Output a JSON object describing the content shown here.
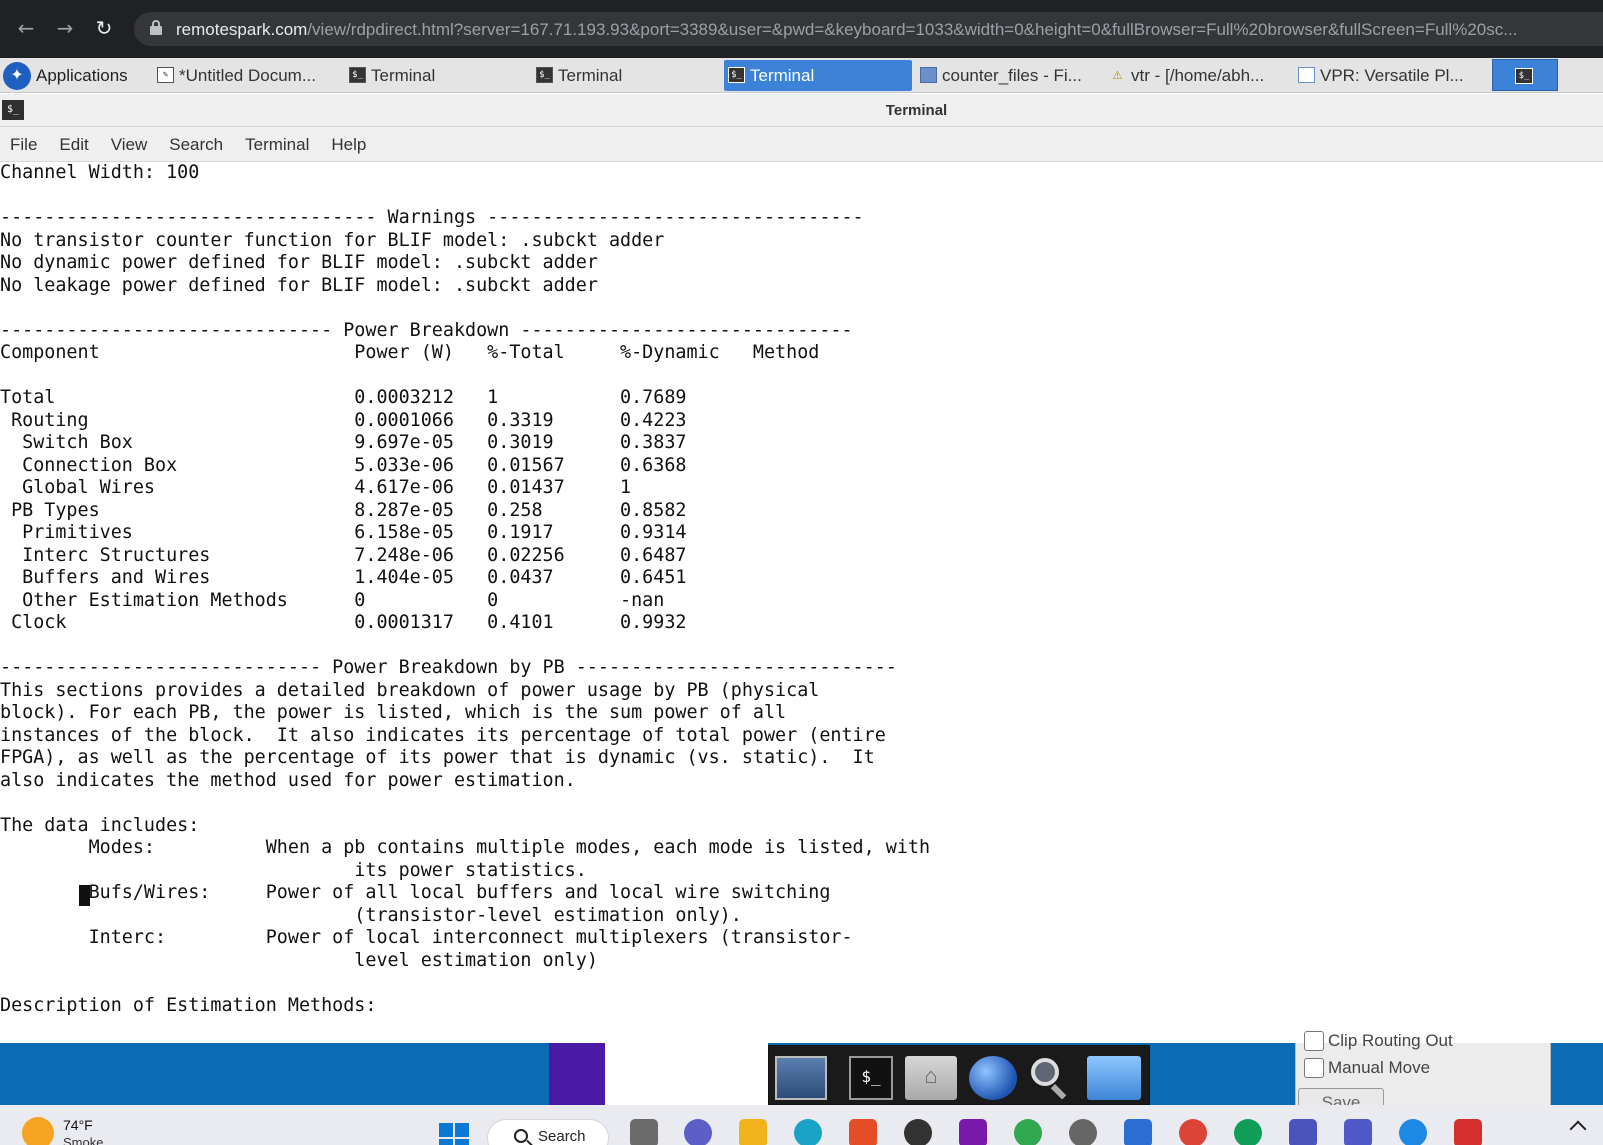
{
  "browser": {
    "url_host": "remotespark.com",
    "url_path": "/view/rdpdirect.html?server=167.71.193.93&port=3389&user=&pwd=&keyboard=1033&width=0&height=0&fullBrowser=Full%20browser&fullScreen=Full%20sc..."
  },
  "xfce_panel": {
    "applications_label": "Applications",
    "tasks": [
      {
        "label": "*Untitled Docum...",
        "icon": "document-icon"
      },
      {
        "label": "Terminal",
        "icon": "terminal-icon"
      },
      {
        "label": "Terminal",
        "icon": "terminal-icon"
      },
      {
        "label": "Terminal",
        "icon": "terminal-icon",
        "active": true
      },
      {
        "label": "counter_files - Fi...",
        "icon": "folder-icon"
      },
      {
        "label": "vtr - [/home/abh...",
        "icon": "vtr-icon"
      },
      {
        "label": "VPR: Versatile Pl...",
        "icon": "window-icon"
      }
    ]
  },
  "window": {
    "title": "Terminal",
    "menu": [
      "File",
      "Edit",
      "View",
      "Search",
      "Terminal",
      "Help"
    ]
  },
  "terminal": {
    "lines": [
      "Channel Width: 100",
      "",
      "---------------------------------- Warnings ----------------------------------",
      "No transistor counter function for BLIF model: .subckt adder",
      "No dynamic power defined for BLIF model: .subckt adder",
      "No leakage power defined for BLIF model: .subckt adder",
      "",
      "------------------------------ Power Breakdown ------------------------------",
      "Component                       Power (W)   %-Total     %-Dynamic   Method",
      "",
      "Total                           0.0003212   1           0.7689",
      " Routing                        0.0001066   0.3319      0.4223",
      "  Switch Box                    9.697e-05   0.3019      0.3837",
      "  Connection Box                5.033e-06   0.01567     0.6368",
      "  Global Wires                  4.617e-06   0.01437     1",
      " PB Types                       8.287e-05   0.258       0.8582",
      "  Primitives                    6.158e-05   0.1917      0.9314",
      "  Interc Structures             7.248e-06   0.02256     0.6487",
      "  Buffers and Wires             1.404e-05   0.0437      0.6451",
      "  Other Estimation Methods      0           0           -nan",
      " Clock                          0.0001317   0.4101      0.9932",
      "",
      "----------------------------- Power Breakdown by PB -----------------------------",
      "This sections provides a detailed breakdown of power usage by PB (physical",
      "block). For each PB, the power is listed, which is the sum power of all",
      "instances of the block.  It also indicates its percentage of total power (entire",
      "FPGA), as well as the percentage of its power that is dynamic (vs. static).  It",
      "also indicates the method used for power estimation.",
      "",
      "The data includes:",
      "        Modes:          When a pb contains multiple modes, each mode is listed, with",
      "                                its power statistics.",
      "        Bufs/Wires:     Power of all local buffers and local wire switching",
      "                                (transistor-level estimation only).",
      "        Interc:         Power of local interconnect multiplexers (transistor-",
      "                                level estimation only)",
      "",
      "Description of Estimation Methods:"
    ]
  },
  "dock": {
    "dialog": {
      "clip_label": "Clip Routing Out",
      "manual_move_label": "Manual Move",
      "save_label": "Save"
    }
  },
  "windows_taskbar": {
    "weather_temp": "74°F",
    "weather_desc": "Smoke",
    "search_label": "Search",
    "start_color": "#0a78d4"
  }
}
